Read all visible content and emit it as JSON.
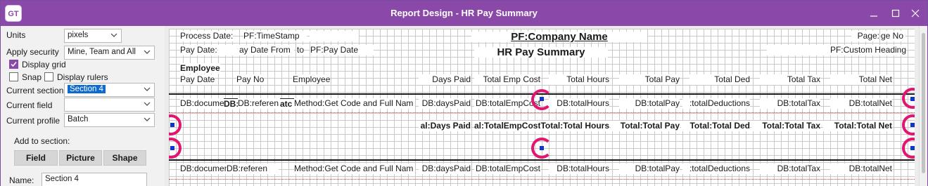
{
  "window": {
    "logo": "GT",
    "title": "Report Design - HR Pay Summary"
  },
  "left_panel": {
    "units_label": "Units",
    "units_value": "pixels",
    "apply_security_label": "Apply security",
    "apply_security_value": "Mine, Team and All",
    "display_grid_label": "Display grid",
    "display_grid_checked": true,
    "snap_label": "Snap",
    "snap_checked": false,
    "display_rulers_label": "Display rulers",
    "display_rulers_checked": false,
    "current_section_label": "Current section",
    "current_section_value": "Section 4",
    "current_field_label": "Current field",
    "current_field_value": "",
    "current_profile_label": "Current profile",
    "current_profile_value": "Batch",
    "add_to_section_label": "Add to section:",
    "buttons": {
      "field": "Field",
      "picture": "Picture",
      "shape": "Shape"
    },
    "name_label": "Name:",
    "name_value": "Section 4"
  },
  "report": {
    "header": {
      "process_date_label": "Process Date:",
      "timestamp": "PF:TimeStamp",
      "company_name": "PF:Company Name",
      "page_label": "Page:",
      "page_no": "ge No",
      "pay_date_label": "Pay Date:",
      "pay_date_from": "ay Date From",
      "to": "to",
      "pay_date": "PF:Pay Date",
      "report_title": "HR Pay Summary",
      "custom_heading": "PF:Custom Heading"
    },
    "columns": {
      "group": "Employee",
      "pay_date": "Pay Date",
      "pay_no": "Pay No",
      "employee": "Employee",
      "days_paid": "Days Paid",
      "total_emp_cost": "Total Emp Cost",
      "total_hours": "Total Hours",
      "total_pay": "Total Pay",
      "total_ded": "Total Ded",
      "total_tax": "Total Tax",
      "total_net": "Total Net"
    },
    "detail_row": {
      "document": "DB:docume",
      "ref_short": "DB:",
      "reference": "DB:referen",
      "method_prefix": "atc",
      "method": "Method:Get Code and Full Nam",
      "days_paid": "DB:daysPaid",
      "emp_cost": "DB:totalEmpCost",
      "hours": "DB:totalHours",
      "pay": "DB:totalPay",
      "deductions": ":totalDeductions",
      "tax": "DB:totalTax",
      "net": "DB:totalNet"
    },
    "totals_row": {
      "days_paid": "al:Days Paid",
      "emp_cost": "al:TotalEmpCost",
      "hours": "Total:Total Hours",
      "pay": "Total:Total Pay",
      "ded": "Total:Total Ded",
      "tax": "Total:Total Tax",
      "net": "Total:Total Net"
    },
    "detail_row_2": {
      "document": "DB:document",
      "reference": "DB:referen",
      "method": "Method:Get Code and Full Nam",
      "days_paid": "DB:daysPaid",
      "emp_cost": "DB:totalEmpCost",
      "hours": "DB:totalHours",
      "pay": "DB:totalPay",
      "deductions": ":totalDeductions",
      "tax": "DB:totalTax",
      "net": "DB:totalNet"
    }
  },
  "colors": {
    "title_bar": "#8a49a8",
    "highlight_ring": "#e2156f",
    "selection_handle": "#1234c8",
    "selected_item": "#0f6ad0"
  },
  "icons": [
    "app-logo-icon",
    "minimize-icon",
    "maximize-icon",
    "close-icon",
    "chevron-down-icon",
    "checkmark-icon"
  ]
}
